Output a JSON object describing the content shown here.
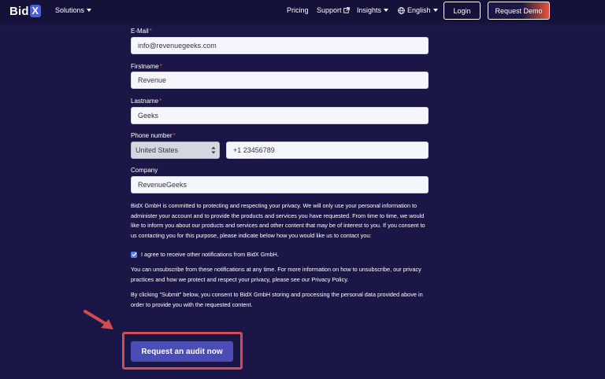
{
  "nav": {
    "logo_text": "Bid",
    "logo_mark": "X",
    "solutions": "Solutions",
    "pricing": "Pricing",
    "support": "Support",
    "insights": "Insights",
    "language": "English",
    "login": "Login",
    "request_demo": "Request Demo",
    "accent_color": "#e8553a"
  },
  "form": {
    "email": {
      "label": "E-Mail",
      "required_mark": "*",
      "value": "info@revenuegeeks.com"
    },
    "firstname": {
      "label": "Firstname",
      "required_mark": "*",
      "value": "Revenue"
    },
    "lastname": {
      "label": "Lastname",
      "required_mark": "*",
      "value": "Geeks"
    },
    "phone": {
      "label": "Phone number",
      "required_mark": "*",
      "country": "United States",
      "value": "+1 23456789"
    },
    "company": {
      "label": "Company",
      "value": "RevenueGeeks"
    },
    "privacy_text": "BidX GmbH is committed to protecting and respecting your privacy. We will only use your personal information to administer your account and to provide the products and services you have requested. From time to time, we would like to inform you about our products and services and other content that may be of interest to you. If you consent to us contacting you for this purpose, please indicate below how you would like us to contact you:",
    "consent_label": "I agree to receive other notifications from BidX GmbH.",
    "consent_checked": true,
    "unsubscribe_text": "You can unsubscribe from these notifications at any time. For more information on how to unsubscribe, our privacy practices and how we protect and respect your privacy, please see our Privacy Policy.",
    "submit_text": "By clicking \"Submit\" below, you consent to BidX GmbH storing and processing the personal data provided above in order to provide you with the requested content.",
    "submit_button": "Request an audit now"
  },
  "annotation": {
    "highlight_color": "#d14b52"
  }
}
